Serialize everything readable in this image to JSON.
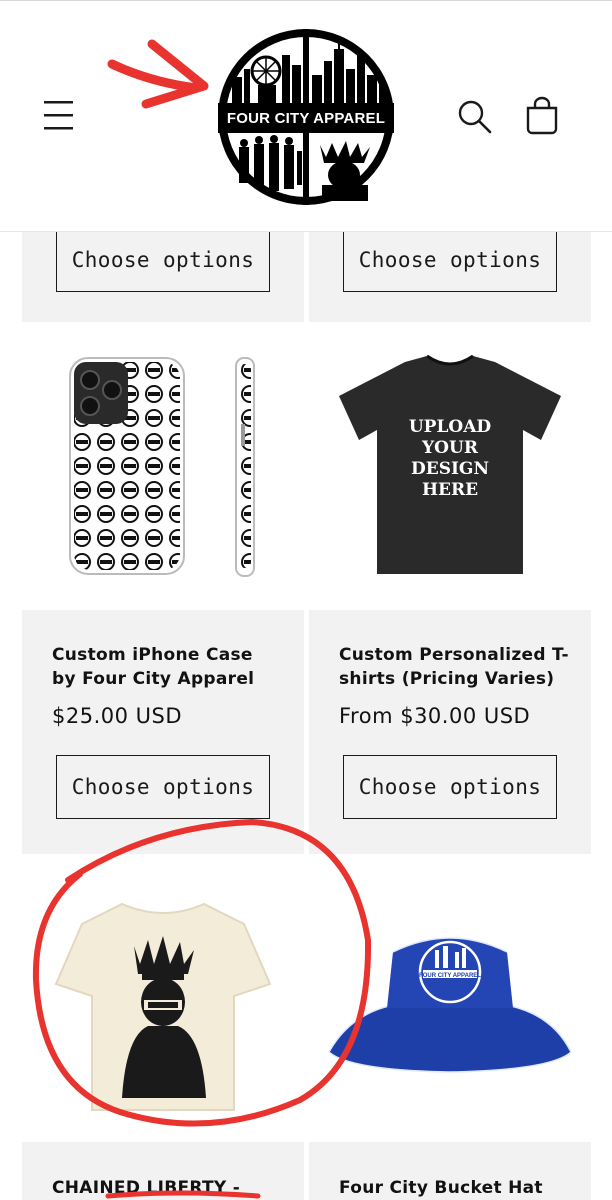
{
  "header": {
    "logo_text": "FOUR CITY APPAREL",
    "menu_icon": "hamburger-menu-icon",
    "search_icon": "search-icon",
    "cart_icon": "cart-icon"
  },
  "products": [
    {
      "button_label": "Choose options"
    },
    {
      "button_label": "Choose options"
    },
    {
      "title": "Custom iPhone Case by Four City Apparel",
      "price": "$25.00 USD",
      "button_label": "Choose options",
      "image_icon": "phone-case-image"
    },
    {
      "title": "Custom Personalized T-shirts (Pricing Varies)",
      "price": "From $30.00 USD",
      "button_label": "Choose options",
      "image_icon": "tshirt-image",
      "image_text": "UPLOAD YOUR DESIGN HERE"
    },
    {
      "title": "CHAINED LIBERTY -",
      "image_icon": "liberty-tshirt-image"
    },
    {
      "title": "Four City Bucket Hat",
      "image_icon": "bucket-hat-image",
      "image_text": "FOUR CITY APPAREL"
    }
  ],
  "colors": {
    "annotation": "#e8332f",
    "card_bg": "#f2f2f2",
    "text": "#121212"
  }
}
